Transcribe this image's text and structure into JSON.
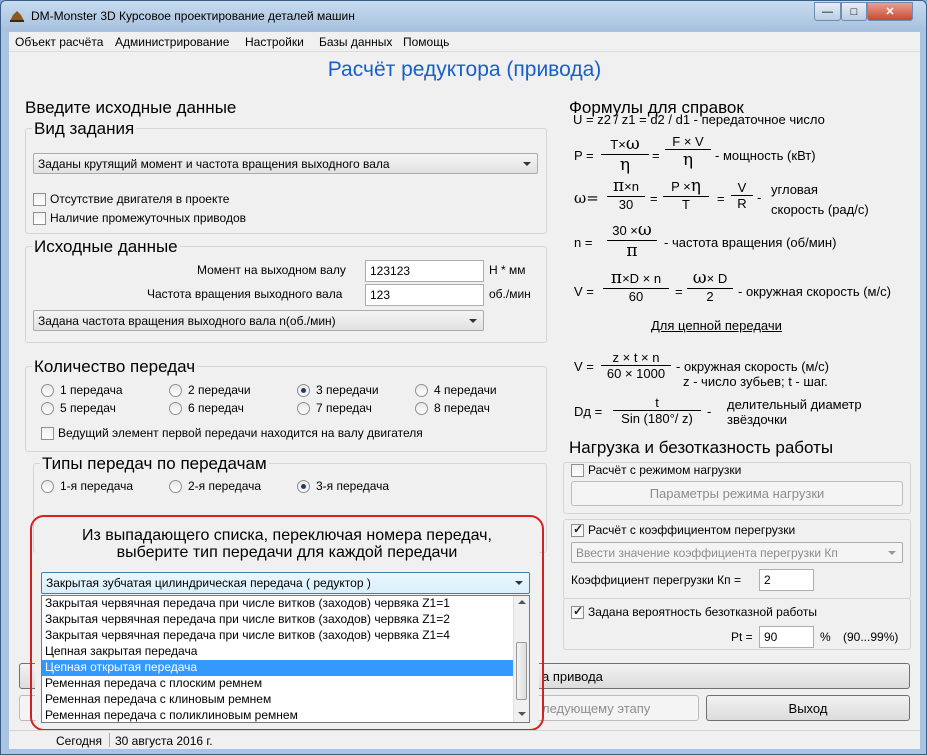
{
  "window": {
    "title": "DM-Monster 3D   Курсовое проектирование деталей машин",
    "minimize": "—",
    "maximize": "□",
    "close": "✕"
  },
  "menu": [
    "Объект расчёта",
    "Администрирование",
    "Настройки",
    "Базы данных",
    "Помощь"
  ],
  "page_title": "Расчёт редуктора (привода)",
  "left": {
    "section_title": "Введите исходные данные",
    "task_type": {
      "title": "Вид задания",
      "combo_value": "Заданы крутящий момент и частота вращения выходного вала",
      "checkboxes": [
        {
          "label": "Отсутствие двигателя в проекте",
          "checked": false
        },
        {
          "label": "Наличие промежуточных приводов",
          "checked": false
        }
      ]
    },
    "initial_data": {
      "title": "Исходные данные",
      "torque_label": "Момент на выходном валу",
      "torque_value": "123123",
      "torque_unit": "Н * мм",
      "speed_label": "Частота вращения выходного вала",
      "speed_value": "123",
      "speed_unit": "об./мин",
      "combo_value": "Задана частота вращения выходного вала n(об./мин)"
    },
    "stages": {
      "title": "Количество передач",
      "options": [
        "1 передача",
        "2 передачи",
        "3 передачи",
        "4 передачи",
        "5 передач",
        "6 передач",
        "7 передач",
        "8 передач"
      ],
      "selected": "3 передачи",
      "motor_checkbox": "Ведущий элемент первой передачи находится на валу двигателя"
    },
    "types": {
      "title": "Типы передач по передачам",
      "tabs": [
        "1-я передача",
        "2-я передача",
        "3-я передача"
      ],
      "selected": "3-я передача"
    },
    "hint_line1": "Из выпадающего списка, переключая номера передач,",
    "hint_line2": "выберите тип передачи для каждой передачи",
    "type_combo_value": "Закрытая зубчатая цилиндрическая передача ( редуктор )",
    "dropdown_items": [
      "Закрытая червячная передача при числе витков (заходов) червяка    Z1=1",
      "Закрытая червячная передача при числе витков (заходов) червяка    Z1=2",
      "Закрытая червячная передача при числе витков (заходов) червяка    Z1=4",
      "Цепная закрытая передача",
      "Цепная открытая передача",
      "Ременная передача с плоским ремнем",
      "Ременная передача с клиновым ремнем",
      "Ременная передача с поликлиновым ремнем"
    ],
    "dropdown_highlighted": "Цепная открытая передача"
  },
  "right": {
    "formulas_title": "Формулы для справок",
    "f_u": "U = z2 / z1 = d2 / d1 - передаточное число",
    "f_p_prefix": "P =",
    "f_p_n1": "T×",
    "f_p_n1_sym": "ω",
    "f_p_d1": "η",
    "f_p_eq": "=",
    "f_p_n2": "F × V",
    "f_p_d2": "η",
    "f_p_desc": "- мощность (кВт)",
    "f_w_prefix": "ω=",
    "f_w_n1_sym": "π",
    "f_w_n1": "×n",
    "f_w_d1": "30",
    "f_w_n2": "P ×",
    "f_w_n2_sym": "η",
    "f_w_d2": "T",
    "f_w_n3": "V",
    "f_w_d3": "R",
    "f_w_desc1": "угловая",
    "f_w_desc2": "скорость (рад/с)",
    "f_n_prefix": "n =",
    "f_n_num": "30 ×",
    "f_n_num_sym": "ω",
    "f_n_den_sym": "π",
    "f_n_desc": "- частота вращения (об/мин)",
    "f_v_prefix": "V =",
    "f_v_n1_sym": "π",
    "f_v_n1": "×D × n",
    "f_v_d1": "60",
    "f_v_n2_sym": "ω",
    "f_v_n2": "× D",
    "f_v_d2": "2",
    "f_v_desc": "- окружная скорость (м/с)",
    "chain_title": "Для цепной передачи",
    "f_vc_prefix": "V =",
    "f_vc_num": "z × t × n",
    "f_vc_den": "60 × 1000",
    "f_vc_desc1": "- окружная скорость (м/с)",
    "f_vc_desc2": "z - число зубьев; t - шаг.",
    "f_dd_prefix": "Dд =",
    "f_dd_num": "t",
    "f_dd_den": "Sin (180°/ z)",
    "f_dd_desc1": "делительный диаметр",
    "f_dd_desc2": "звёздочки",
    "load_title": "Нагрузка и безотказность работы",
    "load_checkbox": "Расчёт с режимом нагрузки",
    "load_button": "Параметры режима нагрузки",
    "overload_checkbox": "Расчёт с коэффициентом перегрузки",
    "overload_combo": "Ввести значение коэффициента перегрузки Кп",
    "kp_label": "Коэффициент перегрузки   Кп =",
    "kp_value": "2",
    "prob_checkbox": "Задана вероятность безотказной работы",
    "pt_label": "Pt =",
    "pt_value": "90",
    "pt_unit": "%",
    "pt_range": "(90...99%)"
  },
  "buttons": {
    "calc_partial": "а привода",
    "next_partial": "ледующему этапу",
    "exit": "Выход"
  },
  "status": {
    "today_label": "Сегодня",
    "date": "30 августа 2016 г."
  }
}
